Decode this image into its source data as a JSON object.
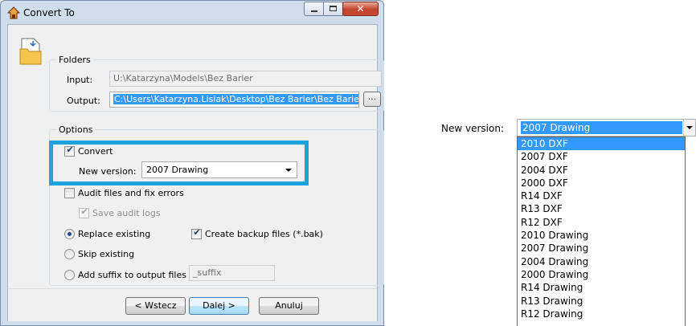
{
  "window": {
    "title": "Convert To"
  },
  "folders": {
    "group_title": "Folders",
    "input_label": "Input:",
    "input_value": "U:\\Katarzyna\\Models\\Bez Barier",
    "output_label": "Output:",
    "output_value": "C:\\Users\\Katarzyna.Lisiak\\Desktop\\Bez Barier\\Bez Barier",
    "browse_label": "..."
  },
  "options": {
    "group_title": "Options",
    "convert_label": "Convert",
    "convert_checked": true,
    "new_version_label": "New version:",
    "new_version_value": "2007 Drawing",
    "audit_label": "Audit files and fix errors",
    "audit_checked": false,
    "save_audit_label": "Save audit logs",
    "save_audit_checked": true,
    "replace_label": "Replace existing",
    "create_backup_label": "Create backup files (*.bak)",
    "create_backup_checked": true,
    "skip_label": "Skip existing",
    "add_suffix_label": "Add suffix to output files",
    "suffix_value": "_suffix",
    "selected_mode": "replace"
  },
  "buttons": {
    "back": "< Wstecz",
    "next": "Dalej >",
    "cancel": "Anuluj"
  },
  "dropdown": {
    "label": "New version:",
    "value": "2007 Drawing",
    "items": [
      "2010 DXF",
      "2007 DXF",
      "2004 DXF",
      "2000 DXF",
      "R14 DXF",
      "R13 DXF",
      "R12 DXF",
      "2010 Drawing",
      "2007 Drawing",
      "2004 Drawing",
      "2000 Drawing",
      "R14 Drawing",
      "R13 Drawing",
      "R12 Drawing"
    ],
    "highlighted_item": "2010 DXF"
  },
  "colors": {
    "highlight_border": "#1ea1dc",
    "selection": "#3399ff"
  }
}
